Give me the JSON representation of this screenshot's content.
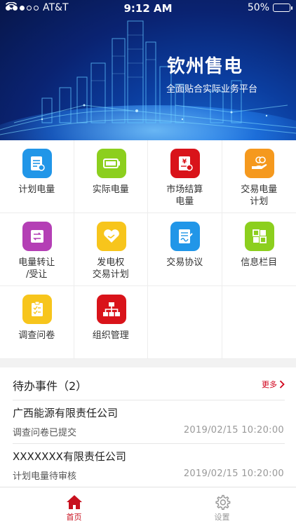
{
  "status_bar": {
    "carrier": "AT&T",
    "time": "9:12 AM",
    "battery": "50%"
  },
  "banner": {
    "title": "钦州售电",
    "subtitle": "全面贴合实际业务平台"
  },
  "grid": [
    {
      "label": "计划电量",
      "icon": "plan-document-icon",
      "color": "#2196e8"
    },
    {
      "label": "实际电量",
      "icon": "battery-icon",
      "color": "#8ccf1e"
    },
    {
      "label": "市场结算\n电量",
      "icon": "settlement-invoice-icon",
      "color": "#d9131a"
    },
    {
      "label": "交易电量\n计划",
      "icon": "coin-hand-icon",
      "color": "#f5991e"
    },
    {
      "label": "电量转让\n/受让",
      "icon": "transfer-arrows-icon",
      "color": "#b43fb5"
    },
    {
      "label": "发电权\n交易计划",
      "icon": "handshake-heart-icon",
      "color": "#f7c51c"
    },
    {
      "label": "交易协议",
      "icon": "agreement-sign-icon",
      "color": "#2196e8"
    },
    {
      "label": "信息栏目",
      "icon": "info-grid-icon",
      "color": "#8ccf1e"
    },
    {
      "label": "调查问卷",
      "icon": "survey-clipboard-icon",
      "color": "#f7c51c"
    },
    {
      "label": "组织管理",
      "icon": "org-chart-icon",
      "color": "#d9131a"
    }
  ],
  "todo": {
    "title": "待办事件（2）",
    "more_label": "更多",
    "items": [
      {
        "company": "广西能源有限责任公司",
        "status": "调查问卷已提交",
        "datetime": "2019/02/15  10:20:00"
      },
      {
        "company": "XXXXXXX有限责任公司",
        "status": "计划电量待审核",
        "datetime": "2019/02/15  10:20:00"
      }
    ]
  },
  "tabbar": {
    "home_label": "首页",
    "settings_label": "设置",
    "active_color": "#c8101e",
    "inactive_color": "#999999"
  }
}
